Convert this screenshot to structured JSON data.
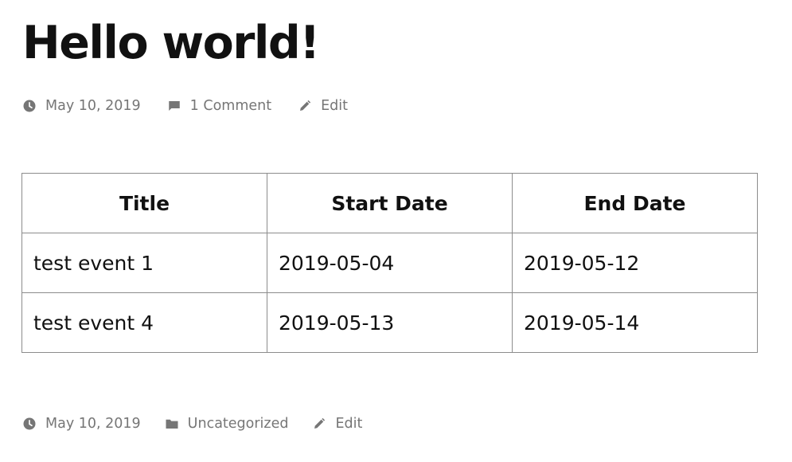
{
  "post": {
    "title": "Hello world!"
  },
  "meta_top": {
    "date": "May 10, 2019",
    "comments": "1 Comment",
    "edit": "Edit"
  },
  "table": {
    "headers": [
      "Title",
      "Start Date",
      "End Date"
    ],
    "rows": [
      [
        "test event 1",
        "2019-05-04",
        "2019-05-12"
      ],
      [
        "test event 4",
        "2019-05-13",
        "2019-05-14"
      ]
    ]
  },
  "meta_bottom": {
    "date": "May 10, 2019",
    "category": "Uncategorized",
    "edit": "Edit"
  },
  "icons": {
    "date": "clock-icon",
    "comments": "comment-icon",
    "edit": "pencil-icon",
    "category": "folder-icon"
  },
  "colors": {
    "text": "#111111",
    "meta": "#767676",
    "border": "#8c8c8c"
  }
}
